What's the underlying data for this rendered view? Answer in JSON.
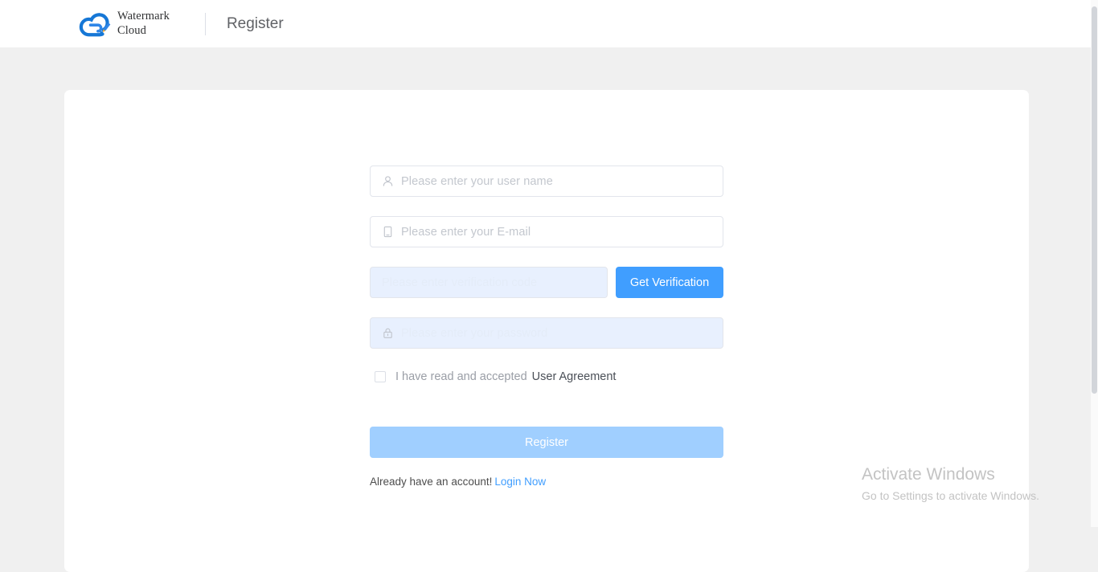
{
  "header": {
    "brand_line1": "Watermark",
    "brand_line2": "Cloud",
    "logo_icon": "cloud-pen-logo-icon",
    "divider": "header-divider",
    "title": "Register"
  },
  "form": {
    "username": {
      "icon": "user-icon",
      "placeholder": "Please enter your user name",
      "value": ""
    },
    "email": {
      "icon": "mobile-icon",
      "placeholder": "Please enter your E-mail",
      "value": ""
    },
    "verification": {
      "placeholder": "Please enter verification code",
      "value": "",
      "button_label": "Get Verification"
    },
    "password": {
      "icon": "lock-icon",
      "placeholder": "Please enter your password",
      "value": ""
    },
    "agreement": {
      "checked": false,
      "text": "I have read and accepted",
      "link_label": "User Agreement"
    },
    "submit_label": "Register",
    "login_prompt": "Already have an account!",
    "login_link_label": "Login Now"
  },
  "watermark": {
    "title": "Activate Windows",
    "subtitle": "Go to Settings to activate Windows."
  },
  "colors": {
    "accent_blue": "#409eff",
    "disabled_blue": "#a0cfff",
    "page_background": "#f0f0f0",
    "card_background": "#ffffff",
    "autofill_background": "#e8f0fe",
    "placeholder_gray": "#c3c7ce",
    "watermark_gray": "#c3c3c3"
  }
}
